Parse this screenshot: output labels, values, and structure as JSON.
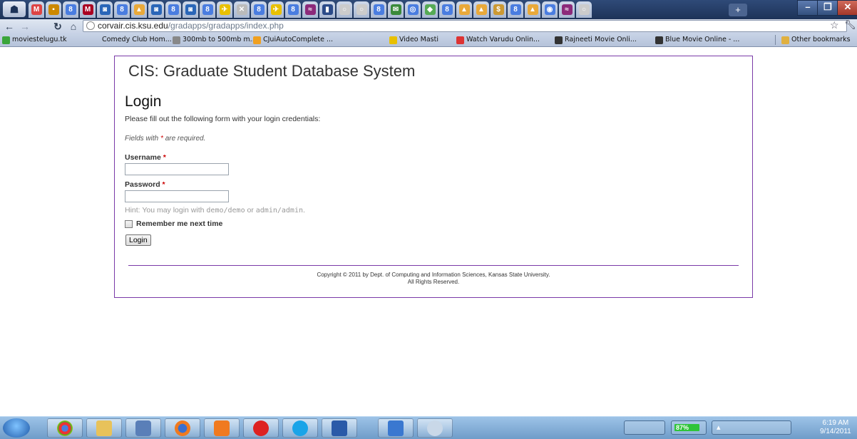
{
  "browser": {
    "url_host": "corvair.cis.ksu.edu",
    "url_path": "/gradapps/gradapps/index.php",
    "bookmarks": [
      {
        "label": "moviestelugu.tk",
        "color": "#3aa53a"
      },
      {
        "label": "Comedy Club Hom...",
        "color": "#000000"
      },
      {
        "label": "300mb to 500mb m...",
        "color": "#777777"
      },
      {
        "label": "CJuiAutoComplete ...",
        "color": "#f0a020"
      },
      {
        "label": "Video Masti",
        "color": "#e8c000"
      },
      {
        "label": "Watch Varudu Onlin...",
        "color": "#d33"
      },
      {
        "label": "Rajneeti Movie Onli...",
        "color": "#333333"
      },
      {
        "label": "Blue Movie Online - ...",
        "color": "#333333"
      }
    ],
    "other_bookmarks": "Other bookmarks"
  },
  "page": {
    "site_title": "CIS: Graduate Student Database System",
    "heading": "Login",
    "intro": "Please fill out the following form with your login credentials:",
    "required_note_pre": "Fields with ",
    "required_star": "*",
    "required_note_post": " are required.",
    "username_label": "Username",
    "username_value": "",
    "password_label": "Password",
    "password_value": "",
    "hint_pre": "Hint: You may login with ",
    "hint_demo": "demo/demo",
    "hint_mid": " or ",
    "hint_admin": "admin/admin",
    "hint_end": ".",
    "remember_label": "Remember me next time",
    "login_button": "Login",
    "footer_line1": "Copyright © 2011 by Dept. of Computing and Information Sciences, Kansas State University.",
    "footer_line2": "All Rights Reserved."
  },
  "taskbar": {
    "battery_percent_label": "87%",
    "battery_level": 0.87,
    "time": "6:19 AM",
    "date": "9/14/2011"
  }
}
